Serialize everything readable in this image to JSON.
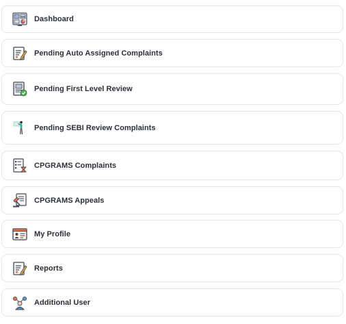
{
  "menu": {
    "items": [
      {
        "id": "dashboard",
        "label": "Dashboard",
        "icon": "dashboard-icon"
      },
      {
        "id": "pending-auto-assigned",
        "label": "Pending Auto Assigned Complaints",
        "icon": "document-pen-icon"
      },
      {
        "id": "pending-first-level-review",
        "label": "Pending First Level Review",
        "icon": "certificate-check-icon"
      },
      {
        "id": "pending-sebi-review",
        "label": "Pending SEBI Review Complaints",
        "icon": "person-presenting-icon"
      },
      {
        "id": "cpgrams-complaints",
        "label": "CPGRAMS Complaints",
        "icon": "checklist-hourglass-icon"
      },
      {
        "id": "cpgrams-appeals",
        "label": "CPGRAMS Appeals",
        "icon": "gavel-document-icon"
      },
      {
        "id": "my-profile",
        "label": "My Profile",
        "icon": "id-card-icon"
      },
      {
        "id": "reports",
        "label": "Reports",
        "icon": "report-pen-icon"
      },
      {
        "id": "additional-user",
        "label": "Additional User",
        "icon": "users-network-icon"
      }
    ]
  }
}
